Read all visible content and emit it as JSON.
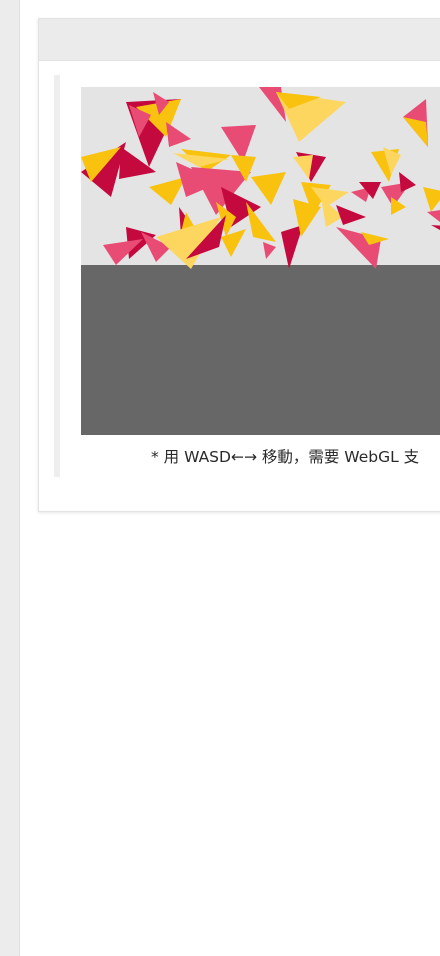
{
  "demo": {
    "caption": "* 用 WASD←→ 移動，需要 WebGL 支"
  },
  "colors": {
    "sky": "#e4e4e4",
    "ground": "#676767",
    "crimson": "#c4093e",
    "pink": "#e84c74",
    "gold": "#f9c20e",
    "light_gold": "#fdd660"
  }
}
